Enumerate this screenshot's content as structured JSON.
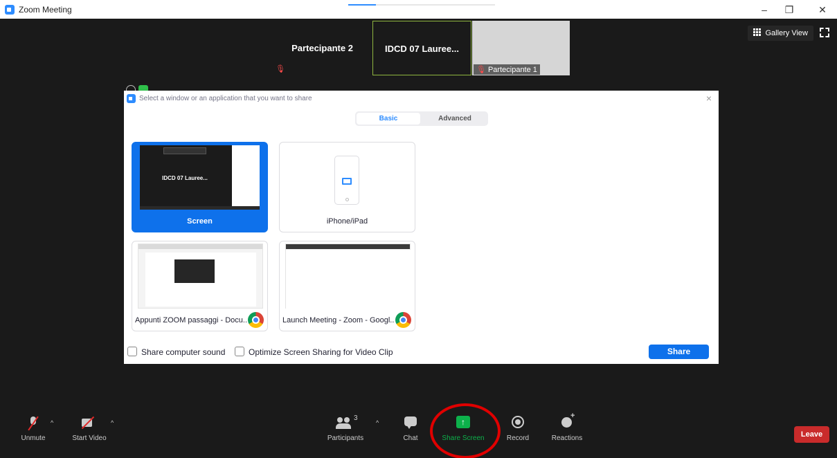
{
  "window": {
    "title": "Zoom Meeting",
    "minimize": "–",
    "restore": "❐",
    "close": "✕",
    "accent": "#2d8cff"
  },
  "video_strip": [
    {
      "name": "Partecipante 2",
      "muted": true
    },
    {
      "name": "IDCD 07 Lauree...",
      "active": true
    },
    {
      "name": "Partecipante 1",
      "muted": true,
      "camera": true
    }
  ],
  "view_controls": {
    "gallery_view": "Gallery View",
    "fullscreen_icon": "fullscreen-icon"
  },
  "share_dialog": {
    "title": "Select a window or an application that you want to share",
    "close": "×",
    "tabs": {
      "basic": "Basic",
      "advanced": "Advanced"
    },
    "options": [
      {
        "label": "Screen",
        "selected": true,
        "preview_name": "IDCD 07 Lauree..."
      },
      {
        "label": "iPhone/iPad"
      },
      {
        "label": "Appunti ZOOM passaggi - Docu...",
        "icon": "chrome-icon"
      },
      {
        "label": "Launch Meeting - Zoom - Googl...",
        "icon": "chrome-icon"
      }
    ],
    "share_sound_label": "Share computer sound",
    "optimize_label": "Optimize Screen Sharing for Video Clip",
    "share_button": "Share",
    "share_button_color": "#0e71eb"
  },
  "toolbar": {
    "unmute": "Unmute",
    "start_video": "Start Video",
    "participants": "Participants",
    "participants_count": "3",
    "chat": "Chat",
    "share_screen": "Share Screen",
    "record": "Record",
    "reactions": "Reactions",
    "leave": "Leave",
    "caret": "^",
    "share_color": "#0db14b",
    "leave_color": "#c92b2b"
  }
}
